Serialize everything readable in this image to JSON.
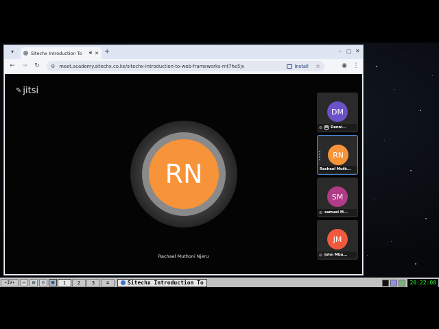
{
  "browser": {
    "tab": {
      "title": "Sitechx Introduction To",
      "close": "✕"
    },
    "url": "meet.academy.sitechx.co.ke/sitechx-introduction-to-web-frameworks-mt7he5jv",
    "install_label": "Install"
  },
  "meeting": {
    "logo_text": "jitsi",
    "dominant_speaker": {
      "initials": "RN",
      "name": "Rachael Muthoni Njeru",
      "color": "#f79339"
    },
    "participants": [
      {
        "initials": "DM",
        "name": "Denni...",
        "color": "#6a52c8",
        "moderator": true,
        "active": false
      },
      {
        "initials": "RN",
        "name": "Rachael Muth...",
        "color": "#f79339",
        "moderator": false,
        "active": true
      },
      {
        "initials": "SM",
        "name": "samuel M...",
        "color": "#b03b86",
        "moderator": false,
        "active": false
      },
      {
        "initials": "JM",
        "name": "John Mbu...",
        "color": "#f05a3c",
        "moderator": false,
        "active": false
      }
    ]
  },
  "taskbar": {
    "start_label": "▾IV▾",
    "workspaces": [
      "1",
      "2",
      "3",
      "4"
    ],
    "active_workspace": "1",
    "task_title": "Sitechx Introduction To",
    "clock": "20:22:00"
  }
}
